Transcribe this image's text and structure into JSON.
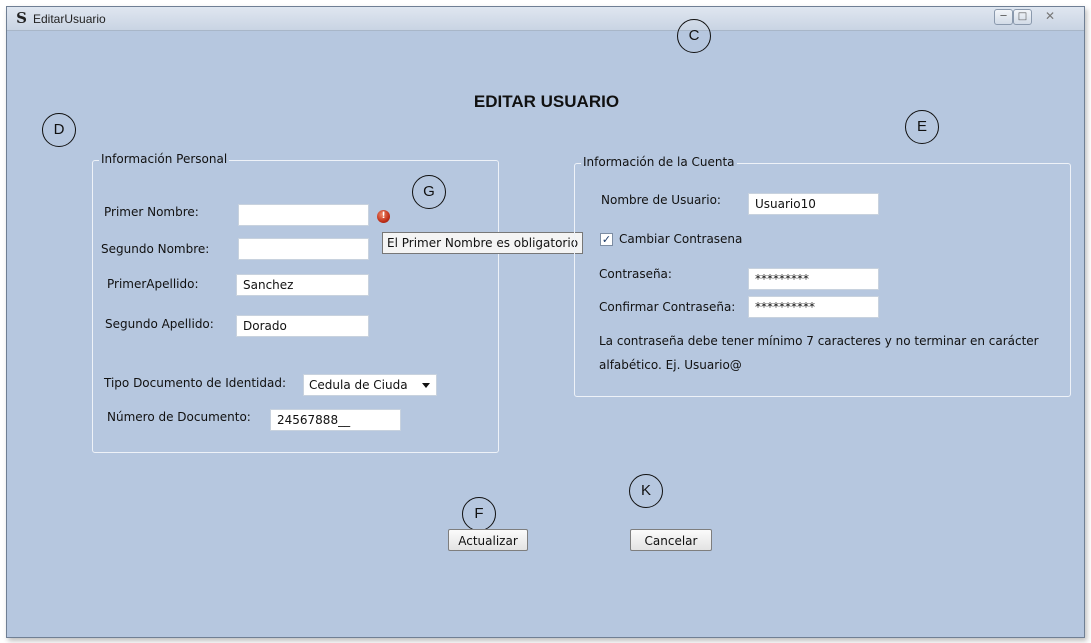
{
  "window": {
    "title": "EditarUsuario",
    "app_icon": "S",
    "minimize_icon": "minimize-icon",
    "maximize_icon": "maximize-icon",
    "close_icon": "close-icon"
  },
  "callouts": {
    "c": "C",
    "d": "D",
    "e": "E",
    "f": "F",
    "g": "G",
    "k": "K"
  },
  "main_title": "EDITAR USUARIO",
  "personal": {
    "legend": "Información Personal",
    "primer_nombre_label": "Primer Nombre:",
    "primer_nombre_value": "",
    "segundo_nombre_label": "Segundo Nombre:",
    "segundo_nombre_value": "",
    "primer_apellido_label": "PrimerApellido:",
    "primer_apellido_value": "Sanchez",
    "segundo_apellido_label": "Segundo Apellido:",
    "segundo_apellido_value": "Dorado",
    "tipo_documento_label": "Tipo Documento de Identidad:",
    "tipo_documento_value": "Cedula de Ciuda",
    "numero_documento_label": "Número de Documento:",
    "numero_documento_value": "24567888__",
    "error_tooltip": "El Primer Nombre es obligatorio"
  },
  "account": {
    "legend": "Información de la Cuenta",
    "usuario_label": "Nombre de Usuario:",
    "usuario_value": "Usuario10",
    "cambiar_label": "Cambiar Contrasena",
    "cambiar_checked": true,
    "check_mark": "✓",
    "contrasena_label": "Contraseña:",
    "contrasena_value": "*********",
    "confirmar_label": "Confirmar Contraseña:",
    "confirmar_value": "**********",
    "note_line1": "La contraseña debe tener mínimo 7 caracteres y no terminar en carácter",
    "note_line2": "alfabético. Ej. Usuario@"
  },
  "buttons": {
    "actualizar": "Actualizar",
    "cancelar": "Cancelar"
  }
}
